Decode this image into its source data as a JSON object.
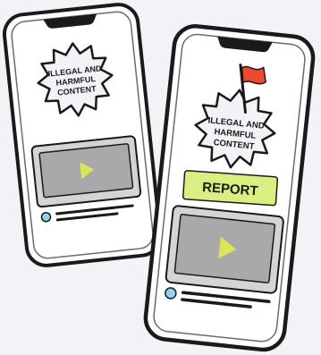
{
  "illustration": {
    "back_phone": {
      "badge_lines": [
        "ILLEGAL AND",
        "HARMFUL",
        "CONTENT"
      ]
    },
    "front_phone": {
      "badge_lines": [
        "ILLEGAL AND",
        "HARMFUL",
        "CONTENT"
      ],
      "report_label": "REPORT"
    },
    "colors": {
      "background": "#f4f2f6",
      "phone_body": "#ffffff",
      "outline": "#1a1a1a",
      "screen_inner_line": "#6b6b6b",
      "video_frame": "#d4d4d6",
      "video_screen": "#a9a9ab",
      "play_icon": "#d9e65a",
      "report_button": "#d9ef82",
      "flag": "#ec4a2e",
      "avatar": "#8fd3ec"
    },
    "icons": [
      "play-icon",
      "flag-icon",
      "avatar-icon"
    ]
  }
}
